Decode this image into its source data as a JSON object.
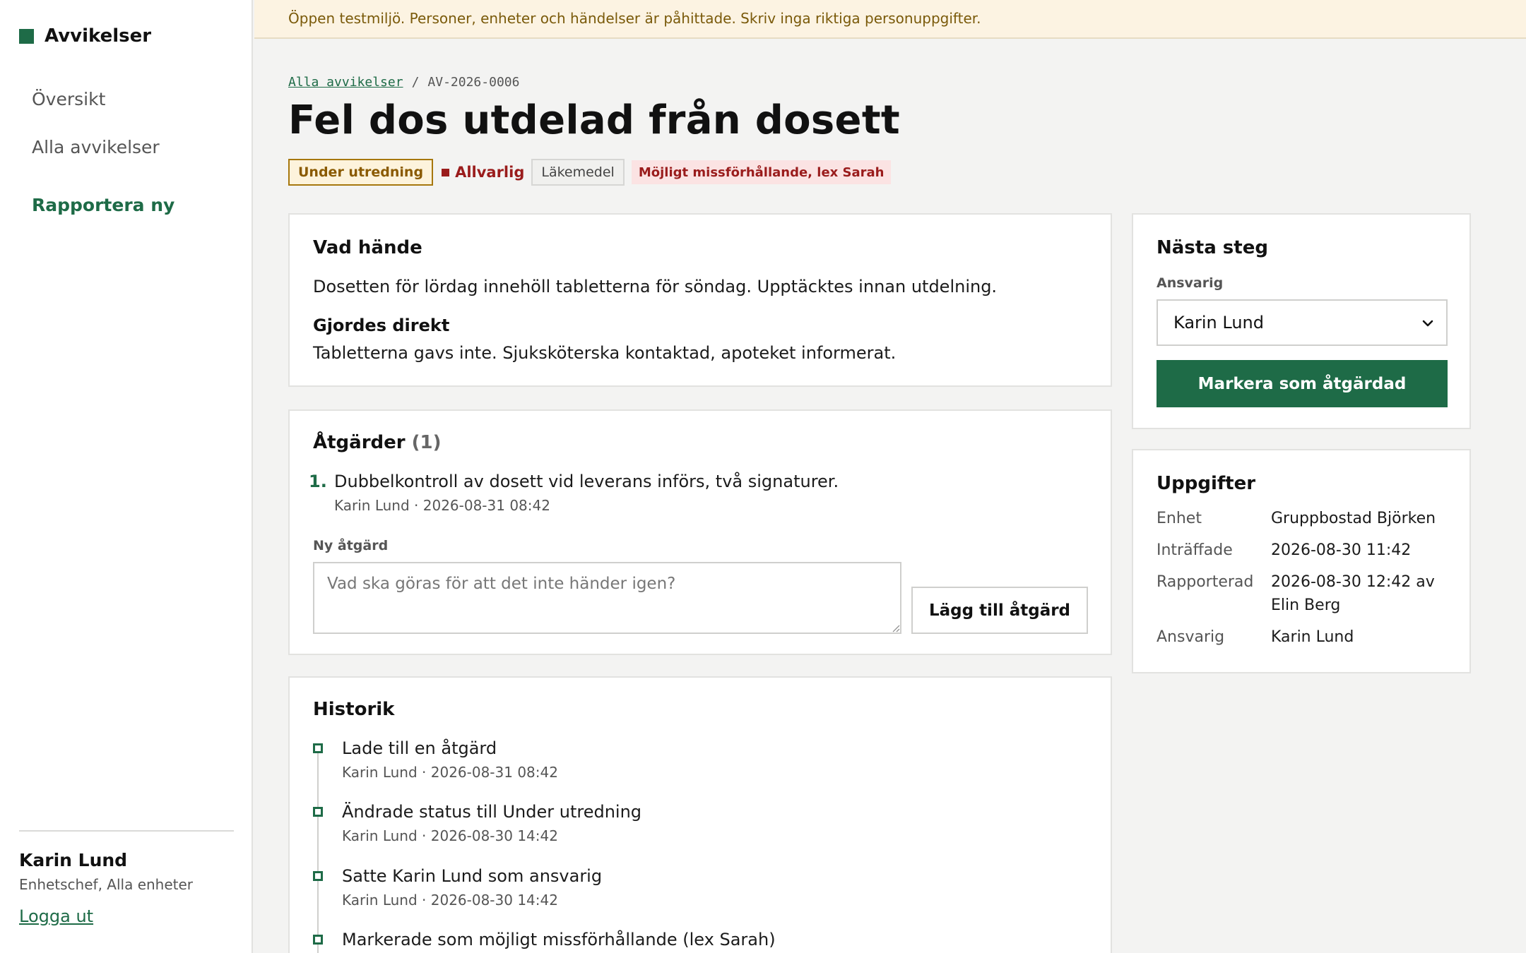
{
  "sidebar": {
    "brand": "Avvikelser",
    "nav": {
      "overview": "Översikt",
      "all": "Alla avvikelser",
      "new": "Rapportera ny"
    },
    "user": {
      "name": "Karin Lund",
      "role": "Enhetschef, Alla enheter",
      "logout": "Logga ut"
    }
  },
  "banner": "Öppen testmiljö. Personer, enheter och händelser är påhittade. Skriv inga riktiga personuppgifter.",
  "breadcrumb": {
    "link": "Alla avvikelser",
    "sep": "/",
    "current": "AV-2026-0006"
  },
  "title": "Fel dos utdelad från dosett",
  "tags": {
    "status": "Under utredning",
    "severity": "Allvarlig",
    "category": "Läkemedel",
    "flag": "Möjligt missförhållande, lex Sarah"
  },
  "what": {
    "heading": "Vad hände",
    "description": "Dosetten för lördag innehöll tabletterna för söndag. Upptäcktes innan utdelning.",
    "done_heading": "Gjordes direkt",
    "done_text": "Tabletterna gavs inte. Sjuksköterska kontaktad, apoteket informerat."
  },
  "actions": {
    "heading": "Åtgärder",
    "count": "(1)",
    "items": [
      {
        "num": "1.",
        "text": "Dubbelkontroll av dosett vid leverans införs, två signaturer.",
        "meta": "Karin Lund · 2026-08-31 08:42"
      }
    ],
    "new_label": "Ny åtgärd",
    "placeholder": "Vad ska göras för att det inte händer igen?",
    "add_button": "Lägg till åtgärd"
  },
  "history": {
    "heading": "Historik",
    "items": [
      {
        "text": "Lade till en åtgärd",
        "meta": "Karin Lund · 2026-08-31 08:42"
      },
      {
        "text": "Ändrade status till Under utredning",
        "meta": "Karin Lund · 2026-08-30 14:42"
      },
      {
        "text": "Satte Karin Lund som ansvarig",
        "meta": "Karin Lund · 2026-08-30 14:42"
      },
      {
        "text": "Markerade som möjligt missförhållande (lex Sarah)",
        "meta": ""
      }
    ]
  },
  "next": {
    "heading": "Nästa steg",
    "resp_label": "Ansvarig",
    "resp_value": "Karin Lund",
    "button": "Markera som åtgärdad"
  },
  "info": {
    "heading": "Uppgifter",
    "rows": [
      {
        "label": "Enhet",
        "value": "Gruppbostad Björken"
      },
      {
        "label": "Inträffade",
        "value": "2026-08-30 11:42"
      },
      {
        "label": "Rapporterad",
        "value": "2026-08-30 12:42 av Elin Berg"
      },
      {
        "label": "Ansvarig",
        "value": "Karin Lund"
      }
    ]
  },
  "colors": {
    "accent": "#1e6b47",
    "warning": "#a6770e",
    "danger": "#9a1c1c",
    "banner_bg": "#fcf3e2"
  }
}
